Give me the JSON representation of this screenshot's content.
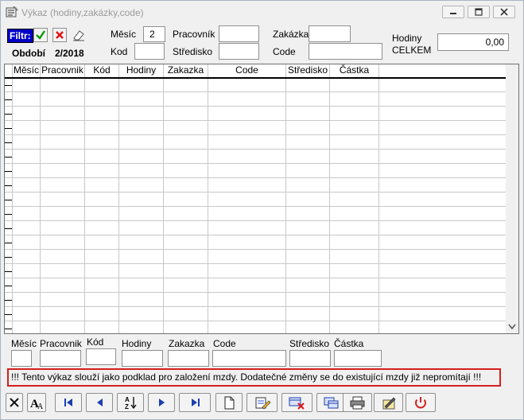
{
  "window": {
    "title": "Výkaz (hodiny,zakázky,code)"
  },
  "filter": {
    "filter_label": "Filtr:",
    "period_label": "Období",
    "period_value": "2/2018",
    "mesic_label": "Měsíc",
    "mesic_value": "2",
    "kod_label": "Kod",
    "kod_value": "",
    "pracovnik_label": "Pracovník",
    "pracovnik_value": "",
    "stredisko_label": "Středisko",
    "stredisko_value": "",
    "zakazka_label": "Zakázka",
    "zakazka_value": "",
    "code_label": "Code",
    "code_value": "",
    "hodiny_label": "Hodiny",
    "celkem_label": "CELKEM",
    "hodiny_celkem_value": "0,00"
  },
  "table": {
    "columns": [
      "Měsíc",
      "Pracovnik",
      "Kód",
      "Hodiny",
      "Zakazka",
      "Code",
      "Středisko",
      "Částka"
    ]
  },
  "bottom": {
    "labels": [
      "Měsíc",
      "Pracovnik",
      "Kód",
      "Hodiny",
      "Zakazka",
      "Code",
      "Středisko",
      "Částka"
    ]
  },
  "notice": "!!! Tento výkaz slouží jako podklad pro založení mzdy. Dodatečné změny se do existující mzdy již nepromítají !!!",
  "colors": {
    "notice_border": "#d61f1f",
    "filter_badge": "#0000c8",
    "nav_blue": "#1a3fb0",
    "power_red": "#d32222"
  },
  "icons": {
    "filter_apply": "check-icon",
    "filter_cancel": "x-icon",
    "filter_clear": "eraser-icon",
    "toolbar": [
      "close-icon",
      "font-icon",
      "first-record-icon",
      "prev-record-icon",
      "sort-az-icon",
      "next-record-icon",
      "last-record-icon",
      "new-document-icon",
      "edit-icon",
      "delete-icon",
      "copy-icon",
      "print-icon",
      "edit-pencil-icon",
      "power-icon"
    ]
  }
}
